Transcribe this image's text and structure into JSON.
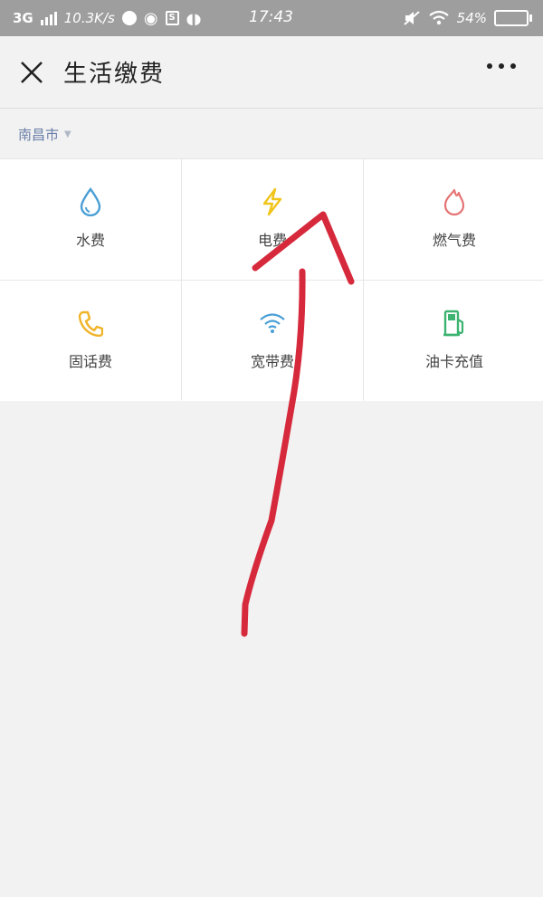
{
  "status_bar": {
    "network": "3G",
    "speed": "10.3K/s",
    "time": "17:43",
    "battery": "54%",
    "battery_level": 0.54,
    "icons": [
      "signal-icon",
      "message-icon",
      "weibo-icon",
      "s-icon",
      "vibrate-icon",
      "mute-icon",
      "wifi-icon",
      "battery-icon"
    ]
  },
  "nav": {
    "title": "生活缴费",
    "close_icon": "close-icon",
    "more_icon": "more-icon"
  },
  "city": {
    "name": "南昌市",
    "caret": "▼"
  },
  "services": [
    {
      "label": "水费",
      "icon": "water-drop-icon",
      "color": "#4a9fd5"
    },
    {
      "label": "电费",
      "icon": "lightning-icon",
      "color": "#f0c419"
    },
    {
      "label": "燃气费",
      "icon": "flame-icon",
      "color": "#e57373"
    },
    {
      "label": "固话费",
      "icon": "phone-icon",
      "color": "#f0b429"
    },
    {
      "label": "宽带费",
      "icon": "wifi-icon",
      "color": "#4a9fd5"
    },
    {
      "label": "油卡充值",
      "icon": "fuel-pump-icon",
      "color": "#3cb371"
    }
  ],
  "annotation_color": "#d62a3c"
}
